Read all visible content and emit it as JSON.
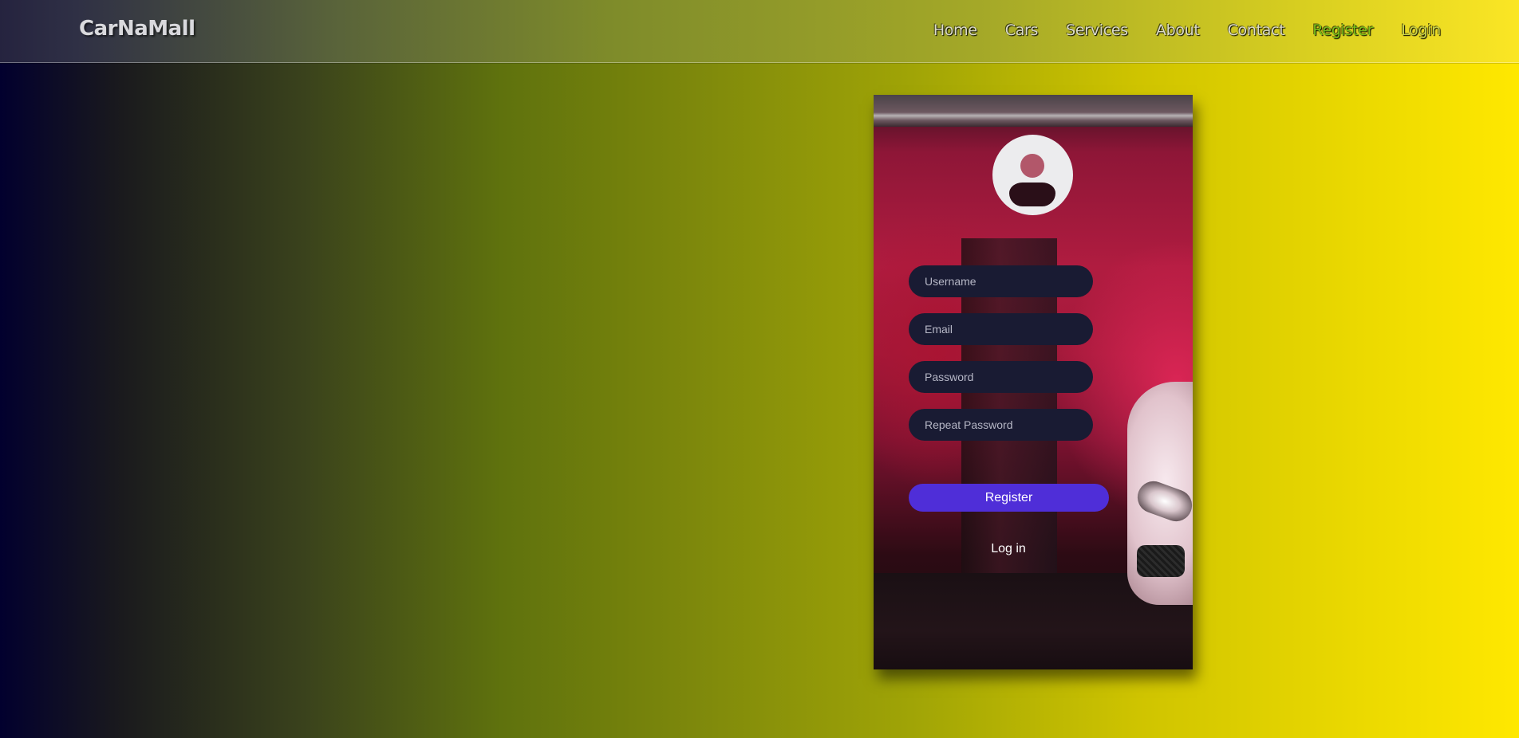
{
  "brand": {
    "name": "CarNaMall"
  },
  "nav": {
    "items": [
      {
        "label": "Home"
      },
      {
        "label": "Cars"
      },
      {
        "label": "Services"
      },
      {
        "label": "About"
      },
      {
        "label": "Contact"
      },
      {
        "label": "Register"
      },
      {
        "label": "Login"
      }
    ],
    "active": "Register"
  },
  "form": {
    "avatar_icon": "user-avatar-icon",
    "username": {
      "placeholder": "Username",
      "value": ""
    },
    "email": {
      "placeholder": "Email",
      "value": ""
    },
    "password": {
      "placeholder": "Password",
      "value": ""
    },
    "repeat_password": {
      "placeholder": "Repeat Password",
      "value": ""
    },
    "submit_label": "Register",
    "login_link": "Log in"
  },
  "colors": {
    "submit_button": "#4f2ed8",
    "input_background": "#191b33",
    "active_nav": "#7bc41b"
  }
}
